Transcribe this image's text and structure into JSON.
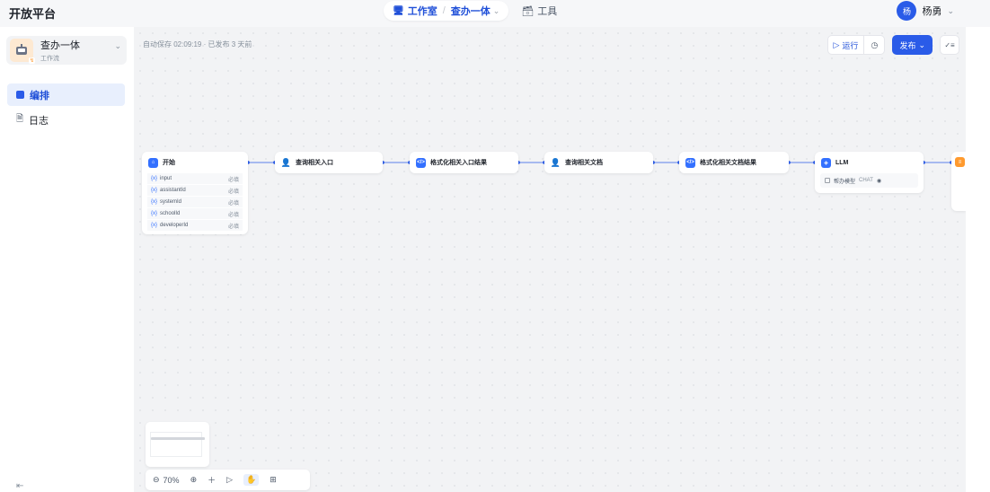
{
  "header": {
    "brand": "开放平台",
    "nav": {
      "workspace_label": "工作室",
      "separator": "/",
      "app_label": "查办一体",
      "tools_label": "工具"
    },
    "user": {
      "avatar_text": "杨",
      "name": "杨勇"
    }
  },
  "sidebar": {
    "app": {
      "name": "查办一体",
      "type": "工作流"
    },
    "items": [
      {
        "label": "编排",
        "active": true
      },
      {
        "label": "日志",
        "active": false
      }
    ]
  },
  "canvas": {
    "autosave": "自动保存 02:09:19 · 已发布 3 天前",
    "toolbar": {
      "run_label": "运行",
      "publish_label": "发布"
    },
    "zoom": {
      "level": "70%"
    }
  },
  "nodes": {
    "start": {
      "title": "开始",
      "params": [
        {
          "tag": "{x}",
          "name": "input",
          "required": "必填"
        },
        {
          "tag": "{x}",
          "name": "assistantId",
          "required": "必填"
        },
        {
          "tag": "{x}",
          "name": "systemId",
          "required": "必填"
        },
        {
          "tag": "{x}",
          "name": "schoolId",
          "required": "必填"
        },
        {
          "tag": "{x}",
          "name": "developerId",
          "required": "必填"
        }
      ]
    },
    "query_entry": {
      "title": "查询相关入口"
    },
    "format_entry": {
      "title": "格式化相关入口结果"
    },
    "query_docs": {
      "title": "查询相关文档"
    },
    "format_docs": {
      "title": "格式化相关文档结果"
    },
    "llm": {
      "title": "LLM",
      "model": "帮办模型",
      "model_mode": "CHAT"
    }
  },
  "colors": {
    "accent": "#2a5be8",
    "active_bg": "#e8effd",
    "canvas_bg": "#f2f3f5",
    "node_icon_blue": "#3370ff",
    "node_icon_orange": "#ff9a2e"
  }
}
